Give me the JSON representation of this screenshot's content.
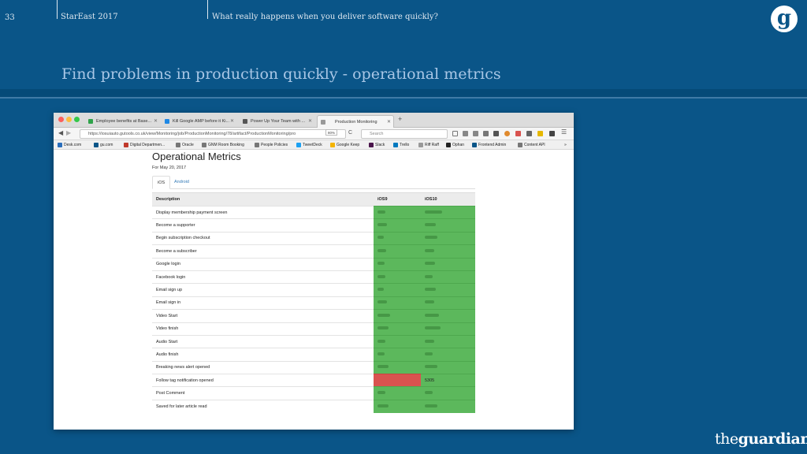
{
  "slide": {
    "number": "33",
    "event": "StarEast 2017",
    "talk_title": "What really happens when you deliver software quickly?",
    "logo_glyph": "g",
    "heading": "Find problems in production quickly  - operational metrics",
    "brand_the": "the",
    "brand_guardian": "guardian"
  },
  "browser": {
    "tabs": [
      {
        "label": "Employee benefits at Base...",
        "active": false
      },
      {
        "label": "Kill Google AMP before it Ki...",
        "active": false
      },
      {
        "label": "Power Up Your Team with ...",
        "active": false
      },
      {
        "label": "Production Monitoring",
        "active": true
      }
    ],
    "url": "https://iosuiauto.gutools.co.uk/view/Monitoring/job/ProductionMonitoring/78/artifact/ProductionMonitoring/pro",
    "zoom": "80%",
    "search_placeholder": "Search",
    "bookmarks": [
      {
        "label": "Desk.com",
        "color": "#2a6ebb"
      },
      {
        "label": "gu.com",
        "color": "#0a5588"
      },
      {
        "label": "Digital Departmen...",
        "color": "#c0392b"
      },
      {
        "label": "Oracle",
        "color": "#777"
      },
      {
        "label": "GNM Room Booking",
        "color": "#777"
      },
      {
        "label": "People Policies",
        "color": "#777"
      },
      {
        "label": "TweetDeck",
        "color": "#1da1f2"
      },
      {
        "label": "Google Keep",
        "color": "#f4b400"
      },
      {
        "label": "Slack",
        "color": "#4a154b"
      },
      {
        "label": "Trello",
        "color": "#0079bf"
      },
      {
        "label": "Riff Raff",
        "color": "#999"
      },
      {
        "label": "Ophan",
        "color": "#222"
      },
      {
        "label": "Frontend Admin",
        "color": "#0a5588"
      },
      {
        "label": "Content API",
        "color": "#777"
      }
    ]
  },
  "page": {
    "title": "Operational Metrics",
    "date": "For May 20, 2017",
    "tabs": [
      "iOS",
      "Android"
    ],
    "columns": [
      "Description",
      "iOS9",
      "iOS10"
    ],
    "rows": [
      {
        "description": "Display membership payment screen",
        "ios9": "",
        "ios10": "",
        "ios9_status": "ok",
        "ios10_status": "ok"
      },
      {
        "description": "Become a supporter",
        "ios9": "",
        "ios10": "",
        "ios9_status": "ok",
        "ios10_status": "ok"
      },
      {
        "description": "Begin subscription checkout",
        "ios9": "",
        "ios10": "",
        "ios9_status": "ok",
        "ios10_status": "ok"
      },
      {
        "description": "Become a subscriber",
        "ios9": "",
        "ios10": "",
        "ios9_status": "ok",
        "ios10_status": "ok"
      },
      {
        "description": "Google login",
        "ios9": "",
        "ios10": "",
        "ios9_status": "ok",
        "ios10_status": "ok"
      },
      {
        "description": "Facebook login",
        "ios9": "",
        "ios10": "",
        "ios9_status": "ok",
        "ios10_status": "ok"
      },
      {
        "description": "Email sign up",
        "ios9": "",
        "ios10": "",
        "ios9_status": "ok",
        "ios10_status": "ok"
      },
      {
        "description": "Email sign in",
        "ios9": "",
        "ios10": "",
        "ios9_status": "ok",
        "ios10_status": "ok"
      },
      {
        "description": "Video Start",
        "ios9": "",
        "ios10": "",
        "ios9_status": "ok",
        "ios10_status": "ok"
      },
      {
        "description": "Video finish",
        "ios9": "",
        "ios10": "",
        "ios9_status": "ok",
        "ios10_status": "ok"
      },
      {
        "description": "Audio Start",
        "ios9": "",
        "ios10": "",
        "ios9_status": "ok",
        "ios10_status": "ok"
      },
      {
        "description": "Audio finish",
        "ios9": "",
        "ios10": "",
        "ios9_status": "ok",
        "ios10_status": "ok"
      },
      {
        "description": "Breaking news alert opened",
        "ios9": "",
        "ios10": "",
        "ios9_status": "ok",
        "ios10_status": "ok"
      },
      {
        "description": "Follow tag notification opened",
        "ios9": "",
        "ios10": "5305",
        "ios9_status": "error",
        "ios10_status": "ok"
      },
      {
        "description": "Post Comment",
        "ios9": "",
        "ios10": "",
        "ios9_status": "ok",
        "ios10_status": "ok"
      },
      {
        "description": "Saved for later article read",
        "ios9": "",
        "ios10": "",
        "ios9_status": "ok",
        "ios10_status": "ok"
      }
    ]
  },
  "colors": {
    "ok": "#5cb85c",
    "error": "#d9534f",
    "slide_bg": "#0a5588"
  }
}
